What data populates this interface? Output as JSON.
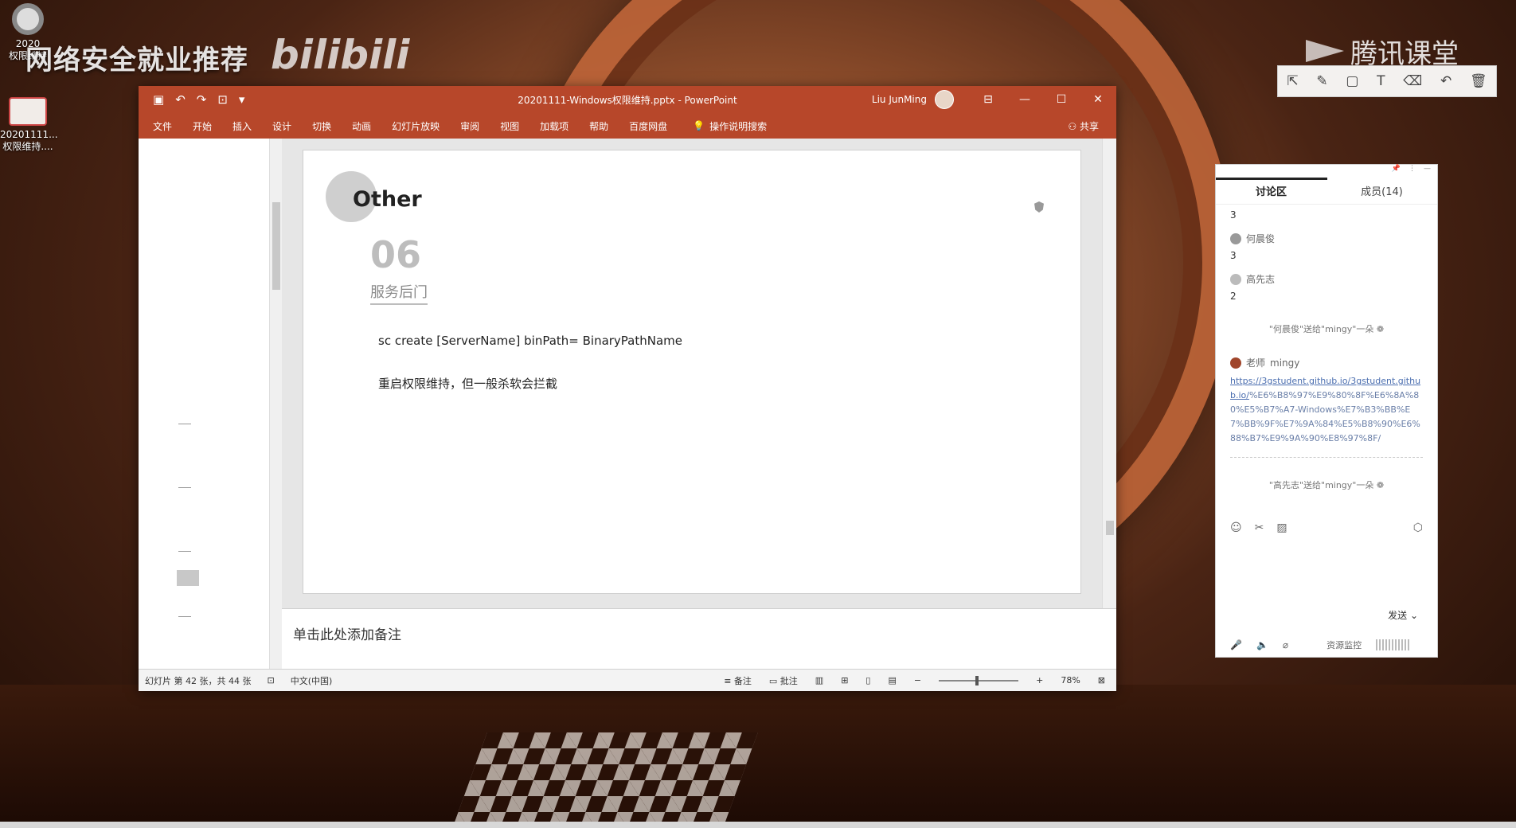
{
  "desktop": {
    "icons": [
      {
        "label_line1": "2020",
        "label_line2": "权限维持",
        "icon": "browser-app-icon"
      },
      {
        "label_line1": "20201111...",
        "label_line2": "权限维持....",
        "icon": "pptx-file-icon"
      }
    ],
    "watermark": "网络安全就业推荐",
    "bili": "bilibili",
    "tencent": "腾讯课堂"
  },
  "annotation_toolbar": {
    "tools": [
      "pointer-icon",
      "pen-icon",
      "rectangle-icon",
      "text-icon",
      "eraser-icon",
      "undo-icon",
      "trash-icon"
    ]
  },
  "ppt": {
    "title": "20201111-Windows权限维持.pptx - PowerPoint",
    "user": "Liu JunMing",
    "ribbon_tabs": [
      "文件",
      "开始",
      "插入",
      "设计",
      "切换",
      "动画",
      "幻灯片放映",
      "审阅",
      "视图",
      "加载项",
      "帮助",
      "百度网盘"
    ],
    "search": "操作说明搜索",
    "share": "共享",
    "slide": {
      "heading": "Other",
      "number": "06",
      "section": "服务后门",
      "line1": "sc create [ServerName] binPath= BinaryPathName",
      "line2": "重启权限维持，但一般杀软会拦截"
    },
    "notes_placeholder": "单击此处添加备注",
    "status": {
      "slide_info": "幻灯片 第 42 张，共 44 张",
      "language": "中文(中国)",
      "notes": "备注",
      "comments": "批注",
      "zoom": "78%"
    }
  },
  "chat": {
    "tabs": [
      "讨论区",
      "成员(14)"
    ],
    "messages": [
      {
        "text": "3"
      },
      {
        "user": "何晨俊",
        "text": "3"
      },
      {
        "user": "高先志",
        "text": "2"
      }
    ],
    "gift1": "\"何晨俊\"送给\"mingy\"一朵",
    "teacher": "mingy",
    "teacher_tag": "老师",
    "link_underlined": "https://3gstudent.github.io/3gstudent.github.io/",
    "link_rest": "%E6%B8%97%E9%80%8F%E6%8A%80%E5%B7%A7-Windows%E7%B3%BB%E7%BB%9F%E7%9A%84%E5%B8%90%E6%88%B7%E9%9A%90%E8%97%8F/",
    "gift2": "\"高先志\"送给\"mingy\"一朵",
    "send": "发送",
    "monitor": "资源监控"
  }
}
